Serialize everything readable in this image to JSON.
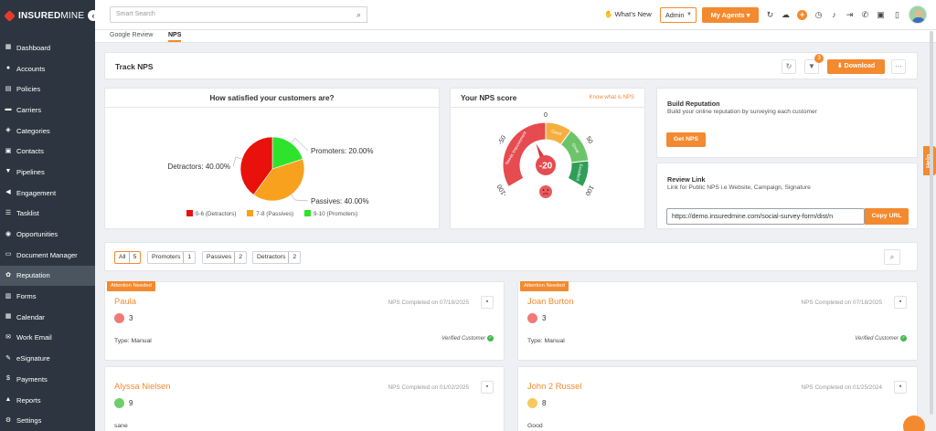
{
  "brand": {
    "name_bold": "INSURED",
    "name_light": "MINE"
  },
  "sidebar": {
    "items": [
      {
        "label": "Dashboard",
        "icon": "dashboard-icon",
        "glyph": "▦"
      },
      {
        "label": "Accounts",
        "icon": "users-icon",
        "glyph": "●"
      },
      {
        "label": "Policies",
        "icon": "document-icon",
        "glyph": "▤"
      },
      {
        "label": "Carriers",
        "icon": "truck-icon",
        "glyph": "▬"
      },
      {
        "label": "Categories",
        "icon": "layers-icon",
        "glyph": "◈"
      },
      {
        "label": "Contacts",
        "icon": "address-book-icon",
        "glyph": "▣"
      },
      {
        "label": "Pipelines",
        "icon": "funnel-icon",
        "glyph": "▼"
      },
      {
        "label": "Engagement",
        "icon": "megaphone-icon",
        "glyph": "◀"
      },
      {
        "label": "Tasklist",
        "icon": "checklist-icon",
        "glyph": "☰"
      },
      {
        "label": "Opportunities",
        "icon": "bulb-icon",
        "glyph": "◉"
      },
      {
        "label": "Document Manager",
        "icon": "folder-icon",
        "glyph": "▭"
      },
      {
        "label": "Reputation",
        "icon": "reputation-icon",
        "glyph": "✿"
      },
      {
        "label": "Forms",
        "icon": "form-icon",
        "glyph": "▥"
      },
      {
        "label": "Calendar",
        "icon": "calendar-icon",
        "glyph": "▦"
      },
      {
        "label": "Work Email",
        "icon": "mail-icon",
        "glyph": "✉"
      },
      {
        "label": "eSignature",
        "icon": "pen-icon",
        "glyph": "✎"
      },
      {
        "label": "Payments",
        "icon": "dollar-icon",
        "glyph": "$"
      },
      {
        "label": "Reports",
        "icon": "chart-icon",
        "glyph": "▲"
      },
      {
        "label": "Settings",
        "icon": "gear-icon",
        "glyph": "⚙"
      }
    ],
    "active": "Reputation"
  },
  "topbar": {
    "search_placeholder": "Smart Search",
    "whats_new": "What's New",
    "admin": "Admin",
    "my_agents": "My Agents"
  },
  "tabs": [
    "Google Review",
    "NPS"
  ],
  "active_tab": "NPS",
  "track": {
    "title": "Track NPS",
    "filter_count": "3",
    "download": "Download"
  },
  "satisfaction": {
    "title": "How satisfied your customers are?",
    "legend": [
      "0-6 (Detractors)",
      "7-8 (Passives)",
      "9-10 (Promoters)"
    ]
  },
  "chart_data": {
    "type": "pie",
    "title": "How satisfied your customers are?",
    "categories": [
      "Detractors",
      "Passives",
      "Promoters"
    ],
    "values": [
      40,
      40,
      20
    ],
    "value_labels": [
      "Detractors: 40.00%",
      "Passives: 40.00%",
      "Promoters: 20.00%"
    ],
    "colors": [
      "#e8110c",
      "#f7a11f",
      "#2ee32b"
    ]
  },
  "nps": {
    "title": "Your NPS score",
    "link": "Know what is NPS",
    "score": "-20",
    "score_value": -20,
    "ticks": [
      "-100",
      "-50",
      "0",
      "50",
      "100"
    ],
    "segments": [
      "Needs Improvement",
      "Good",
      "Great",
      "Excellent"
    ]
  },
  "build_reputation": {
    "title": "Build Reputation",
    "subtitle": "Build your online reputation by surveying each customer",
    "button": "Get NPS"
  },
  "review_link": {
    "title": "Review Link",
    "subtitle": "Link for Public NPS i.e Website, Campaign, Signature",
    "url": "https://demo.insuredmine.com/social-survey-form/dist/n",
    "button": "Copy URL"
  },
  "filters": [
    {
      "label": "All",
      "count": "5"
    },
    {
      "label": "Promoters",
      "count": "1"
    },
    {
      "label": "Passives",
      "count": "2"
    },
    {
      "label": "Detractors",
      "count": "2"
    }
  ],
  "cards": [
    {
      "attention": "Attention Needed",
      "name": "Paula",
      "completed": "NPS Completed on 07/18/2025",
      "score": "3",
      "type": "Type: Manual",
      "face": "sad",
      "verified": "Verified Customer"
    },
    {
      "attention": "Attention Needed",
      "name": "Joan Burton",
      "completed": "NPS Completed on 07/18/2025",
      "score": "3",
      "type": "Type: Manual",
      "face": "sad",
      "verified": "Verified Customer"
    },
    {
      "attention": "",
      "name": "Alyssa Nielsen",
      "completed": "NPS Completed on 01/02/2025",
      "score": "9",
      "type": "sane",
      "face": "happy",
      "verified": ""
    },
    {
      "attention": "",
      "name": "John 2 Russel",
      "completed": "NPS Completed on 01/25/2024",
      "score": "8",
      "type": "Good",
      "face": "neutral",
      "verified": ""
    }
  ],
  "help": "Help"
}
